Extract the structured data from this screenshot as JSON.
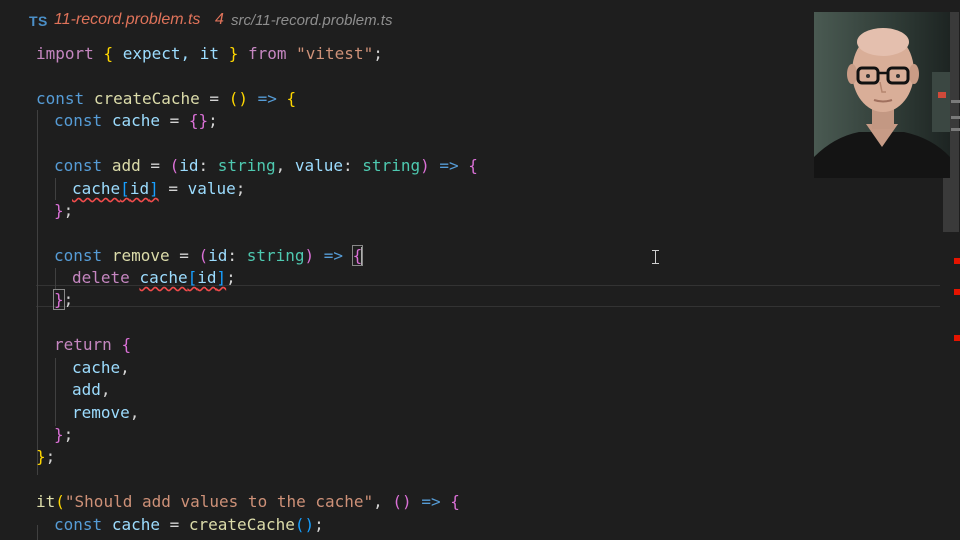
{
  "tab": {
    "lang_badge": "TS",
    "filename": "11-record.problem.ts",
    "problem_count": "4",
    "path": "src/11-record.problem.ts"
  },
  "code": {
    "import_kw": "import",
    "import_names": "expect, it",
    "from_kw": "from",
    "module": "\"vitest\"",
    "const_kw": "const",
    "create_cache_name": "createCache",
    "cache_name": "cache",
    "add_name": "add",
    "remove_name": "remove",
    "id_param": "id",
    "value_param": "value",
    "string_type": "string",
    "delete_kw": "delete",
    "return_kw": "return",
    "it_fn": "it",
    "test_title": "\"Should add values to the cache\""
  },
  "colors": {
    "error_squiggle": "#f14c4c",
    "keyword": "#c586c0",
    "storage": "#569cd6",
    "variable": "#9cdcfe",
    "function": "#dcdcaa",
    "type": "#4ec9b0",
    "string": "#ce9178"
  },
  "icons": {
    "ibeam": "text-cursor-icon"
  }
}
